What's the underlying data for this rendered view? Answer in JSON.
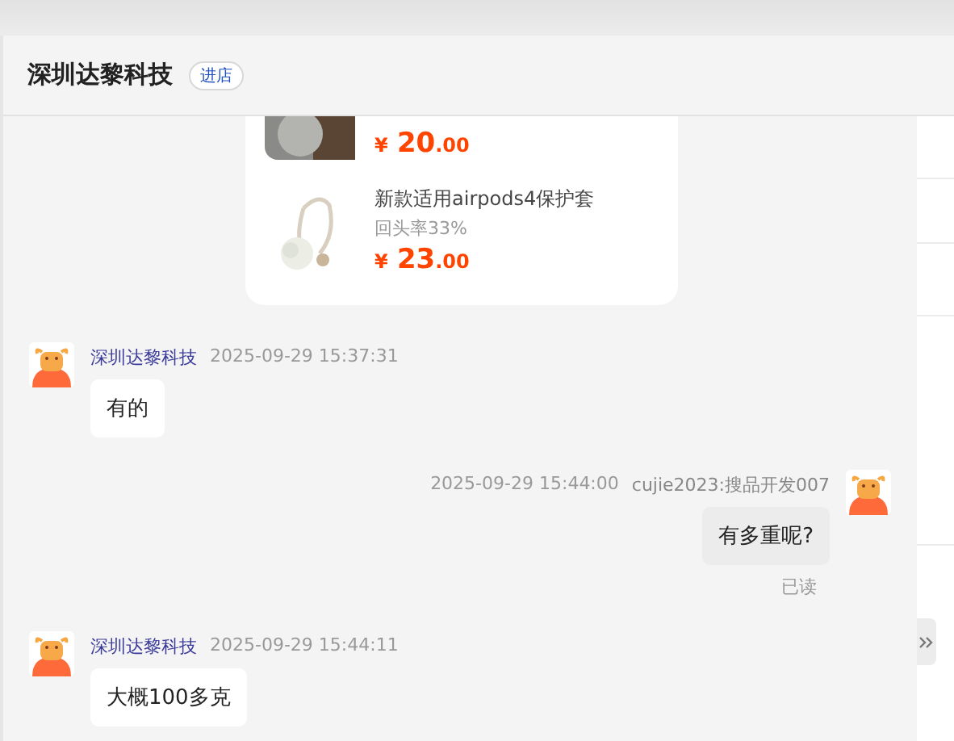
{
  "header": {
    "title": "深圳达黎科技",
    "badge": "进店"
  },
  "product_card": {
    "items": [
      {
        "currency": "¥",
        "price": "20",
        "cents": ".00"
      },
      {
        "name": "新款适用airpods4保护套",
        "return_rate": "回头率33%",
        "currency": "¥",
        "price": "23",
        "cents": ".00"
      }
    ]
  },
  "messages": [
    {
      "kind": "incoming",
      "sender": "深圳达黎科技",
      "time": "2025-09-29 15:37:31",
      "text": "有的"
    },
    {
      "kind": "outgoing",
      "sender": "cujie2023:搜品开发007",
      "time": "2025-09-29 15:44:00",
      "text": "有多重呢?",
      "status": "已读"
    },
    {
      "kind": "incoming",
      "sender": "深圳达黎科技",
      "time": "2025-09-29 15:44:11",
      "text": "大概100多克"
    }
  ]
}
